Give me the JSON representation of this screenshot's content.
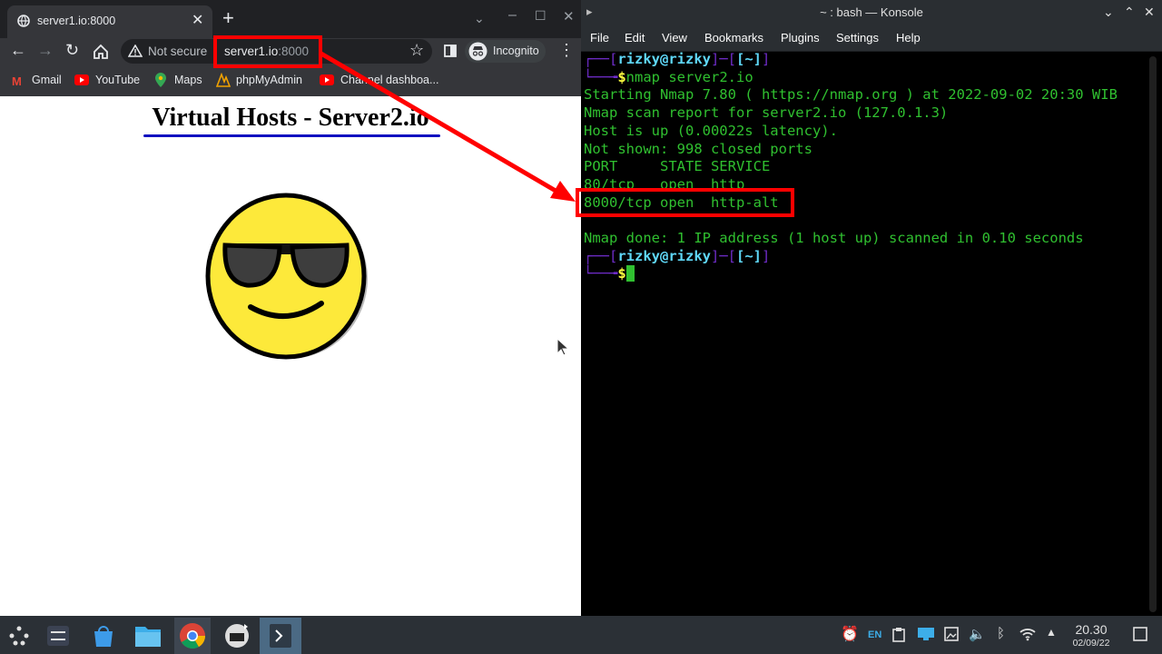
{
  "browser": {
    "tab_title": "server1.io:8000",
    "new_tab": "+",
    "security_text": "Not secure",
    "url_host": "server1.io",
    "url_port": ":8000",
    "profile_label": "Incognito",
    "bookmarks": [
      "Gmail",
      "YouTube",
      "Maps",
      "phpMyAdmin",
      "Channel dashboa..."
    ]
  },
  "page": {
    "title": "Virtual Hosts - Server2.io"
  },
  "konsole": {
    "window_title": "~ : bash — Konsole",
    "menu": [
      "File",
      "Edit",
      "View",
      "Bookmarks",
      "Plugins",
      "Settings",
      "Help"
    ],
    "prompt_user": "rizky@rizky",
    "prompt_dir": "[~]",
    "command": "nmap server2.io",
    "output": [
      "Starting Nmap 7.80 ( https://nmap.org ) at 2022-09-02 20:30 WIB",
      "Nmap scan report for server2.io (127.0.1.3)",
      "Host is up (0.00022s latency).",
      "Not shown: 998 closed ports",
      "PORT     STATE SERVICE",
      "80/tcp   open  http",
      "8000/tcp open  http-alt",
      "",
      "Nmap done: 1 IP address (1 host up) scanned in 0.10 seconds"
    ]
  },
  "taskbar": {
    "lang": "EN",
    "time": "20.30",
    "date": "02/09/22"
  },
  "colors": {
    "annotation": "#ff0000",
    "terminal_green": "#30c030",
    "prompt_purple": "#6e2cc8"
  }
}
